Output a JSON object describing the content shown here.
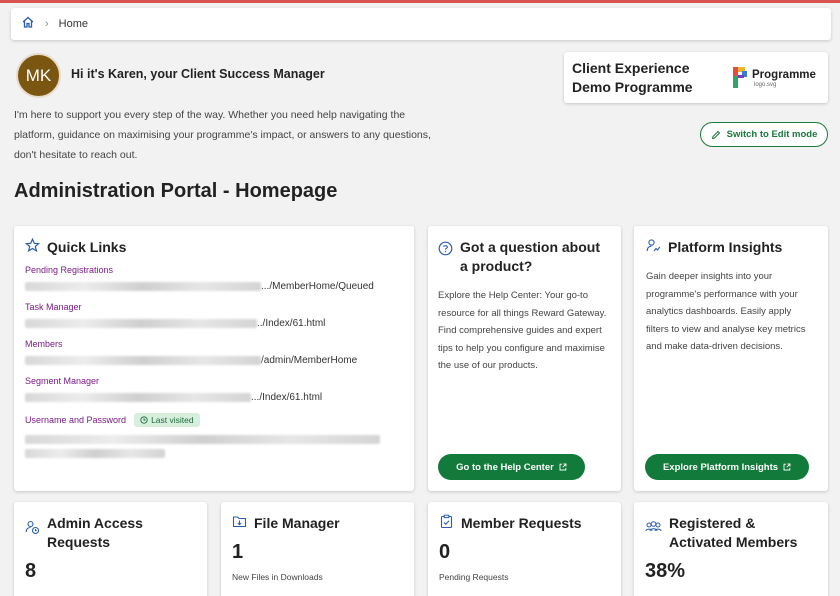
{
  "breadcrumb": {
    "home_icon": "home-icon",
    "current": "Home"
  },
  "manager": {
    "initials": "MK",
    "greeting": "Hi it's Karen, your Client Success Manager",
    "intro": "I'm here to support you every step of the way. Whether you need help navigating the platform, guidance on maximising your programme's impact, or answers to any questions, don't hesitate to reach out."
  },
  "client": {
    "name": "Client Experience Demo Programme",
    "logo_word": "Programme",
    "logo_file": "logo.svg"
  },
  "edit_mode_label": "Switch to Edit mode",
  "page_title": "Administration Portal - Homepage",
  "quick_links": {
    "title": "Quick Links",
    "items": [
      {
        "label": "Pending Registrations",
        "url_tail": ".../MemberHome/Queued",
        "badge": ""
      },
      {
        "label": "Task Manager",
        "url_tail": "../Index/61.html",
        "badge": ""
      },
      {
        "label": "Members",
        "url_tail": "/admin/MemberHome",
        "badge": ""
      },
      {
        "label": "Segment Manager",
        "url_tail": ".../Index/61.html",
        "badge": ""
      },
      {
        "label": "Username and Password",
        "url_tail": "",
        "badge": "Last visited"
      }
    ]
  },
  "help": {
    "title": "Got a question about a product?",
    "text": "Explore the Help Center: Your go-to resource for all things Reward Gateway. Find comprehensive guides and expert tips to help you configure and maximise the use of our products.",
    "button": "Go to the Help Center"
  },
  "insights": {
    "title": "Platform Insights",
    "text": "Gain deeper insights into your programme's performance with your analytics dashboards. Easily apply filters to view and analyse key metrics and make data-driven decisions.",
    "button": "Explore Platform Insights"
  },
  "stats": {
    "admin_access": {
      "title": "Admin Access Requests",
      "value": "8",
      "sub": ""
    },
    "file_manager": {
      "title": "File Manager",
      "value": "1",
      "sub": "New Files in Downloads"
    },
    "member_requests": {
      "title": "Member Requests",
      "value": "0",
      "sub": "Pending Requests"
    },
    "registered": {
      "title": "Registered & Activated Members",
      "value": "38%",
      "sub": ""
    }
  },
  "colors": {
    "accent_green": "#127a3a",
    "link_purple": "#7b1b87",
    "icon_blue": "#2a5db0"
  }
}
